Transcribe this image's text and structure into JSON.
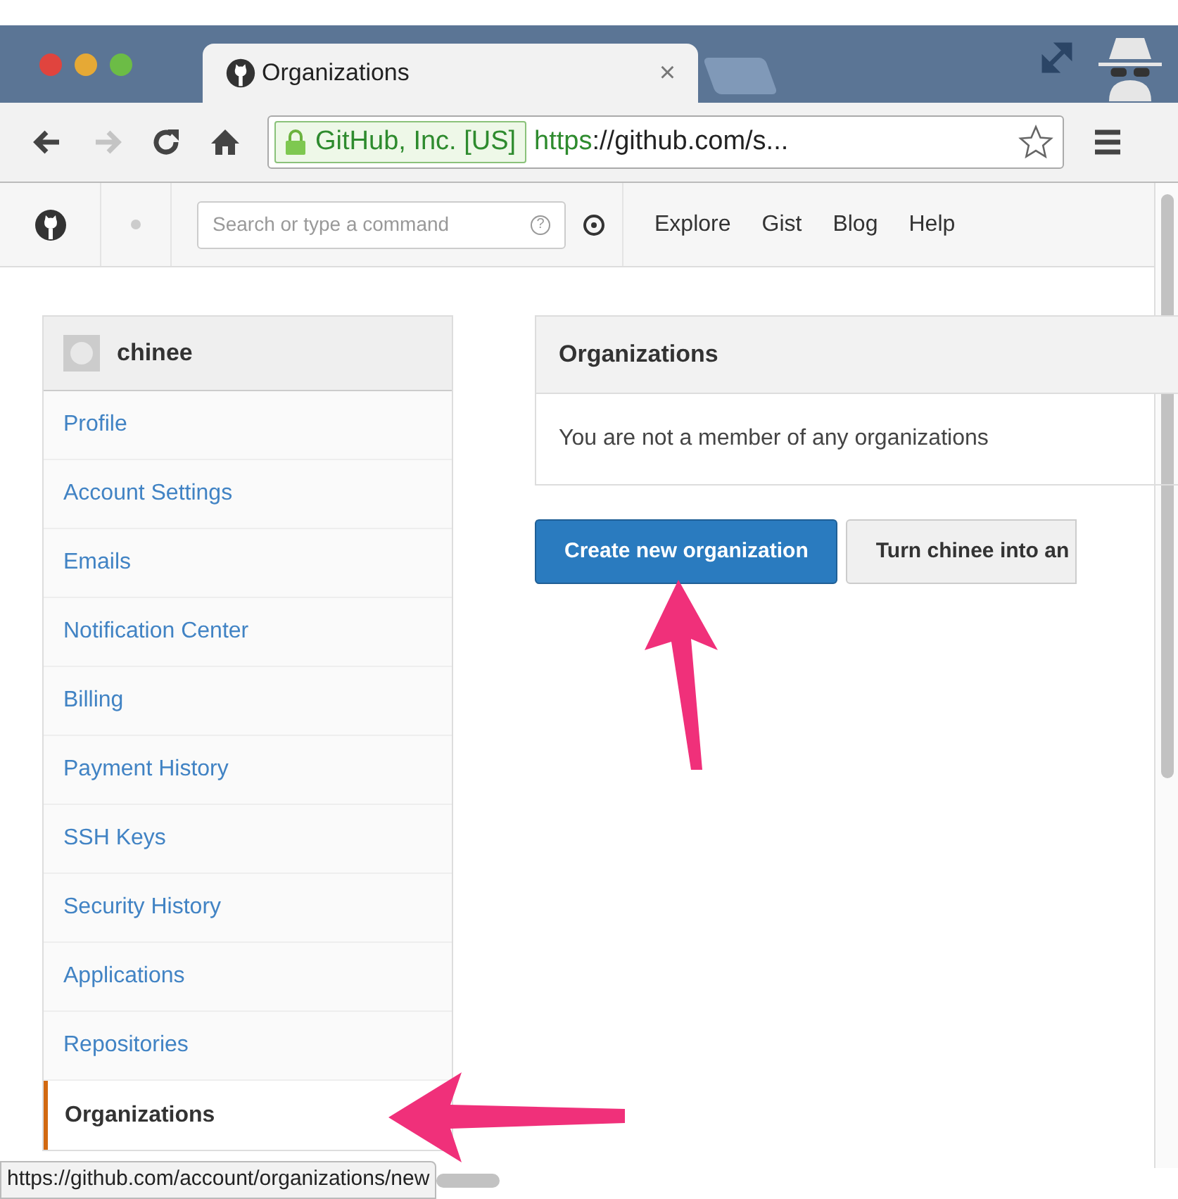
{
  "browser": {
    "tab_title": "Organizations",
    "tab_close": "×",
    "identity": "GitHub, Inc. [US]",
    "url_scheme": "https",
    "url_rest": "://github.com/s..."
  },
  "header": {
    "search": {
      "placeholder": "Search or type a command",
      "help": "?"
    },
    "nav": [
      "Explore",
      "Gist",
      "Blog",
      "Help"
    ]
  },
  "sidebar": {
    "user": "chinee",
    "items": [
      {
        "label": "Profile",
        "selected": false
      },
      {
        "label": "Account Settings",
        "selected": false
      },
      {
        "label": "Emails",
        "selected": false
      },
      {
        "label": "Notification Center",
        "selected": false
      },
      {
        "label": "Billing",
        "selected": false
      },
      {
        "label": "Payment History",
        "selected": false
      },
      {
        "label": "SSH Keys",
        "selected": false
      },
      {
        "label": "Security History",
        "selected": false
      },
      {
        "label": "Applications",
        "selected": false
      },
      {
        "label": "Repositories",
        "selected": false
      },
      {
        "label": "Organizations",
        "selected": true
      }
    ]
  },
  "panel": {
    "title": "Organizations",
    "message": "You are not a member of any organizations"
  },
  "buttons": [
    {
      "label": "Create new organization",
      "kind": "primary"
    },
    {
      "label": "Turn chinee into an",
      "kind": "default"
    }
  ],
  "status_url": "https://github.com/account/organizations/new"
}
